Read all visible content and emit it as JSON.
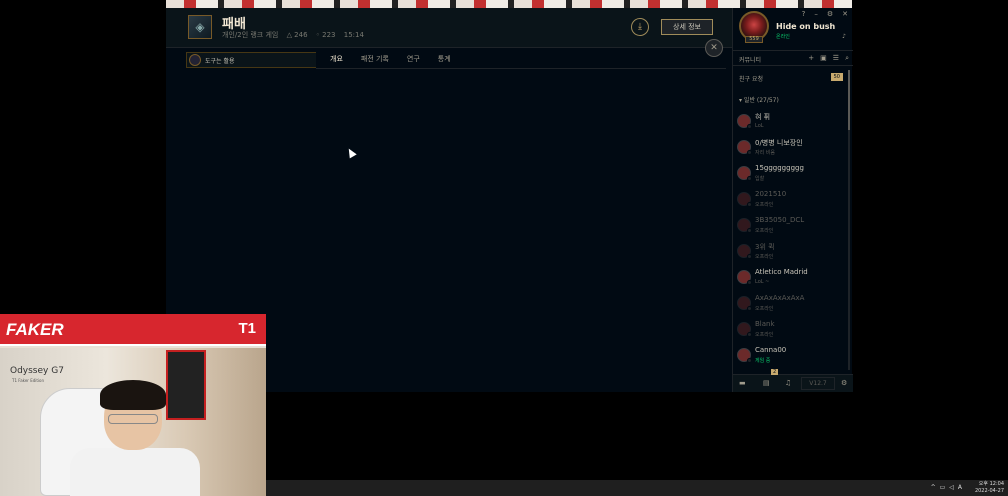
{
  "header": {
    "title": "패배",
    "sub_mode": "개인/2인 랭크 게임",
    "sub_score": "△ 246",
    "sub_gold": "◦ 223",
    "sub_time": "15:14",
    "detail_button": "상세 정보"
  },
  "subnav": {
    "user_label": "도구는 활용",
    "tabs": [
      "개요",
      "패전 기록",
      "연구",
      "통계"
    ]
  },
  "profile": {
    "name": "Hide on bush",
    "status": "온라인",
    "level": "559"
  },
  "social": {
    "community_label": "커뮤니티",
    "requests_label": "친구 요청",
    "requests_count": "50",
    "group_label": "일반 (27/57)"
  },
  "friends": [
    {
      "name": "혀 퓌",
      "status": "LoL",
      "state": "online"
    },
    {
      "name": "0/병병 니보장인",
      "status": "자리 비움",
      "state": "online"
    },
    {
      "name": "15ggggggggg",
      "status": "입찰",
      "state": "online"
    },
    {
      "name": "2021510",
      "status": "오프라인",
      "state": "offline"
    },
    {
      "name": "3B35050_DCL",
      "status": "오프라인",
      "state": "offline"
    },
    {
      "name": "3위 퀵",
      "status": "오프라인",
      "state": "offline"
    },
    {
      "name": "Atletico Madrid",
      "status": "LoL ~",
      "state": "online"
    },
    {
      "name": "AxAxAxAxAxA",
      "status": "오프라인",
      "state": "offline"
    },
    {
      "name": "Blank",
      "status": "오프라인",
      "state": "offline"
    },
    {
      "name": "Canna00",
      "status": "게임 중",
      "state": "ingame"
    }
  ],
  "bottom_bar": {
    "notification_count": "2",
    "version": "V12.7"
  },
  "webcam": {
    "streamer_name": "FAKER",
    "team_logo": "T1",
    "monitor_label": "Odyssey G7",
    "monitor_sub": "T1 Faker Edition"
  },
  "taskbar": {
    "time_period": "오후 12:04",
    "date": "2022-04-27"
  },
  "colors": {
    "client_bg": "#010a13",
    "gold_accent": "#c8aa6e",
    "online_green": "#0acb6d",
    "banner_red": "#d7262e"
  }
}
